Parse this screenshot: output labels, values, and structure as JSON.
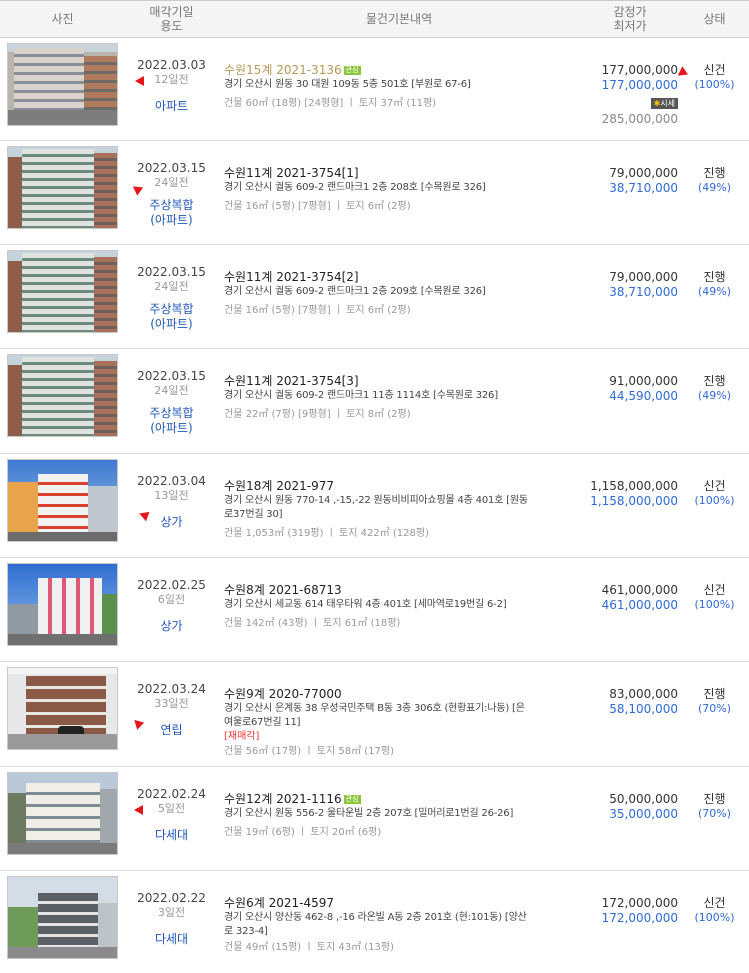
{
  "header": {
    "photo": "사진",
    "date_use_1": "매각기일",
    "date_use_2": "용도",
    "info": "물건기본내역",
    "price_1": "감정가",
    "price_2": "최저가",
    "status": "상태"
  },
  "rows": [
    {
      "date": "2022.03.03",
      "days": "12일전",
      "use": "아파트",
      "use2": "",
      "case": "수원15계 2021-3136",
      "badge": "관심",
      "addr": "경기 오산시 원동 30 대원 109동 5층 501호 [부원로 67-6]",
      "addr2": "",
      "area": "건물 60㎡ (18평) [24평형]  ㅣ  토지 37㎡ (11평)",
      "tag": "",
      "appraisal": "177,000,000",
      "minimum": "177,000,000",
      "market_label": "시세",
      "market_value": "285,000,000",
      "status": "신건",
      "pct": "(100%)"
    },
    {
      "date": "2022.03.15",
      "days": "24일전",
      "use": "주상복합",
      "use2": "(아파트)",
      "case": "수원11계 2021-3754[1]",
      "badge": "",
      "addr": "경기 오산시 궐동 609-2 랜드마크1 2층 208호 [수목원로 326]",
      "addr2": "",
      "area": "건물 16㎡ (5평) [7평형]  ㅣ  토지 6㎡ (2평)",
      "tag": "",
      "appraisal": "79,000,000",
      "minimum": "38,710,000",
      "market_label": "",
      "market_value": "",
      "status": "진행",
      "pct": "(49%)"
    },
    {
      "date": "2022.03.15",
      "days": "24일전",
      "use": "주상복합",
      "use2": "(아파트)",
      "case": "수원11계 2021-3754[2]",
      "badge": "",
      "addr": "경기 오산시 궐동 609-2 랜드마크1 2층 209호 [수목원로 326]",
      "addr2": "",
      "area": "건물 16㎡ (5평) [7평형]  ㅣ  토지 6㎡ (2평)",
      "tag": "",
      "appraisal": "79,000,000",
      "minimum": "38,710,000",
      "market_label": "",
      "market_value": "",
      "status": "진행",
      "pct": "(49%)"
    },
    {
      "date": "2022.03.15",
      "days": "24일전",
      "use": "주상복합",
      "use2": "(아파트)",
      "case": "수원11계 2021-3754[3]",
      "badge": "",
      "addr": "경기 오산시 궐동 609-2 랜드마크1 11층 1114호 [수목원로 326]",
      "addr2": "",
      "area": "건물 22㎡ (7평) [9평형]  ㅣ  토지 8㎡ (2평)",
      "tag": "",
      "appraisal": "91,000,000",
      "minimum": "44,590,000",
      "market_label": "",
      "market_value": "",
      "status": "진행",
      "pct": "(49%)"
    },
    {
      "date": "2022.03.04",
      "days": "13일전",
      "use": "상가",
      "use2": "",
      "case": "수원18계 2021-977",
      "badge": "",
      "addr": "경기 오산시 원동 770-14 ,-15,-22 원동비비피아쇼핑몰 4층 401호 [원동",
      "addr2": "로37번길 30]",
      "area": "건물 1,053㎡ (319평)  ㅣ  토지 422㎡ (128평)",
      "tag": "",
      "appraisal": "1,158,000,000",
      "minimum": "1,158,000,000",
      "market_label": "",
      "market_value": "",
      "status": "신건",
      "pct": "(100%)"
    },
    {
      "date": "2022.02.25",
      "days": "6일전",
      "use": "상가",
      "use2": "",
      "case": "수원8계 2021-68713",
      "badge": "",
      "addr": "경기 오산시 세교동 614 태우타워 4층 401호 [세마역로19번길 6-2]",
      "addr2": "",
      "area": "건물 142㎡ (43평)  ㅣ  토지 61㎡ (18평)",
      "tag": "",
      "appraisal": "461,000,000",
      "minimum": "461,000,000",
      "market_label": "",
      "market_value": "",
      "status": "신건",
      "pct": "(100%)"
    },
    {
      "date": "2022.03.24",
      "days": "33일전",
      "use": "연립",
      "use2": "",
      "case": "수원9계 2020-77000",
      "badge": "",
      "addr": "경기 오산시 은계동 38 우성국민주택 B동 3층 306호 (현황표기:나동) [은",
      "addr2": "여울로67번길 11]",
      "area": "건물 56㎡ (17평)  ㅣ  토지 58㎡ (17평)",
      "tag": "[재매각]",
      "appraisal": "83,000,000",
      "minimum": "58,100,000",
      "market_label": "",
      "market_value": "",
      "status": "진행",
      "pct": "(70%)"
    },
    {
      "date": "2022.02.24",
      "days": "5일전",
      "use": "다세대",
      "use2": "",
      "case": "수원12계 2021-1116",
      "badge": "관심",
      "addr": "경기 오산시 원동 556-2 울타운빌 2층 207호 [밀머리로1번길 26-26]",
      "addr2": "",
      "area": "건물 19㎡ (6평)  ㅣ  토지 20㎡ (6평)",
      "tag": "",
      "appraisal": "50,000,000",
      "minimum": "35,000,000",
      "market_label": "",
      "market_value": "",
      "status": "진행",
      "pct": "(70%)"
    },
    {
      "date": "2022.02.22",
      "days": "3일전",
      "use": "다세대",
      "use2": "",
      "case": "수원6계 2021-4597",
      "badge": "",
      "addr": "경기 오산시 양산동 462-8 ,-16 라온빌 A동 2층 201호 (현:101동) [양산",
      "addr2": "로 323-4]",
      "area": "건물 49㎡ (15평)  ㅣ  토지 43㎡ (13평)",
      "tag": "",
      "appraisal": "172,000,000",
      "minimum": "172,000,000",
      "market_label": "",
      "market_value": "",
      "status": "신건",
      "pct": "(100%)"
    }
  ]
}
